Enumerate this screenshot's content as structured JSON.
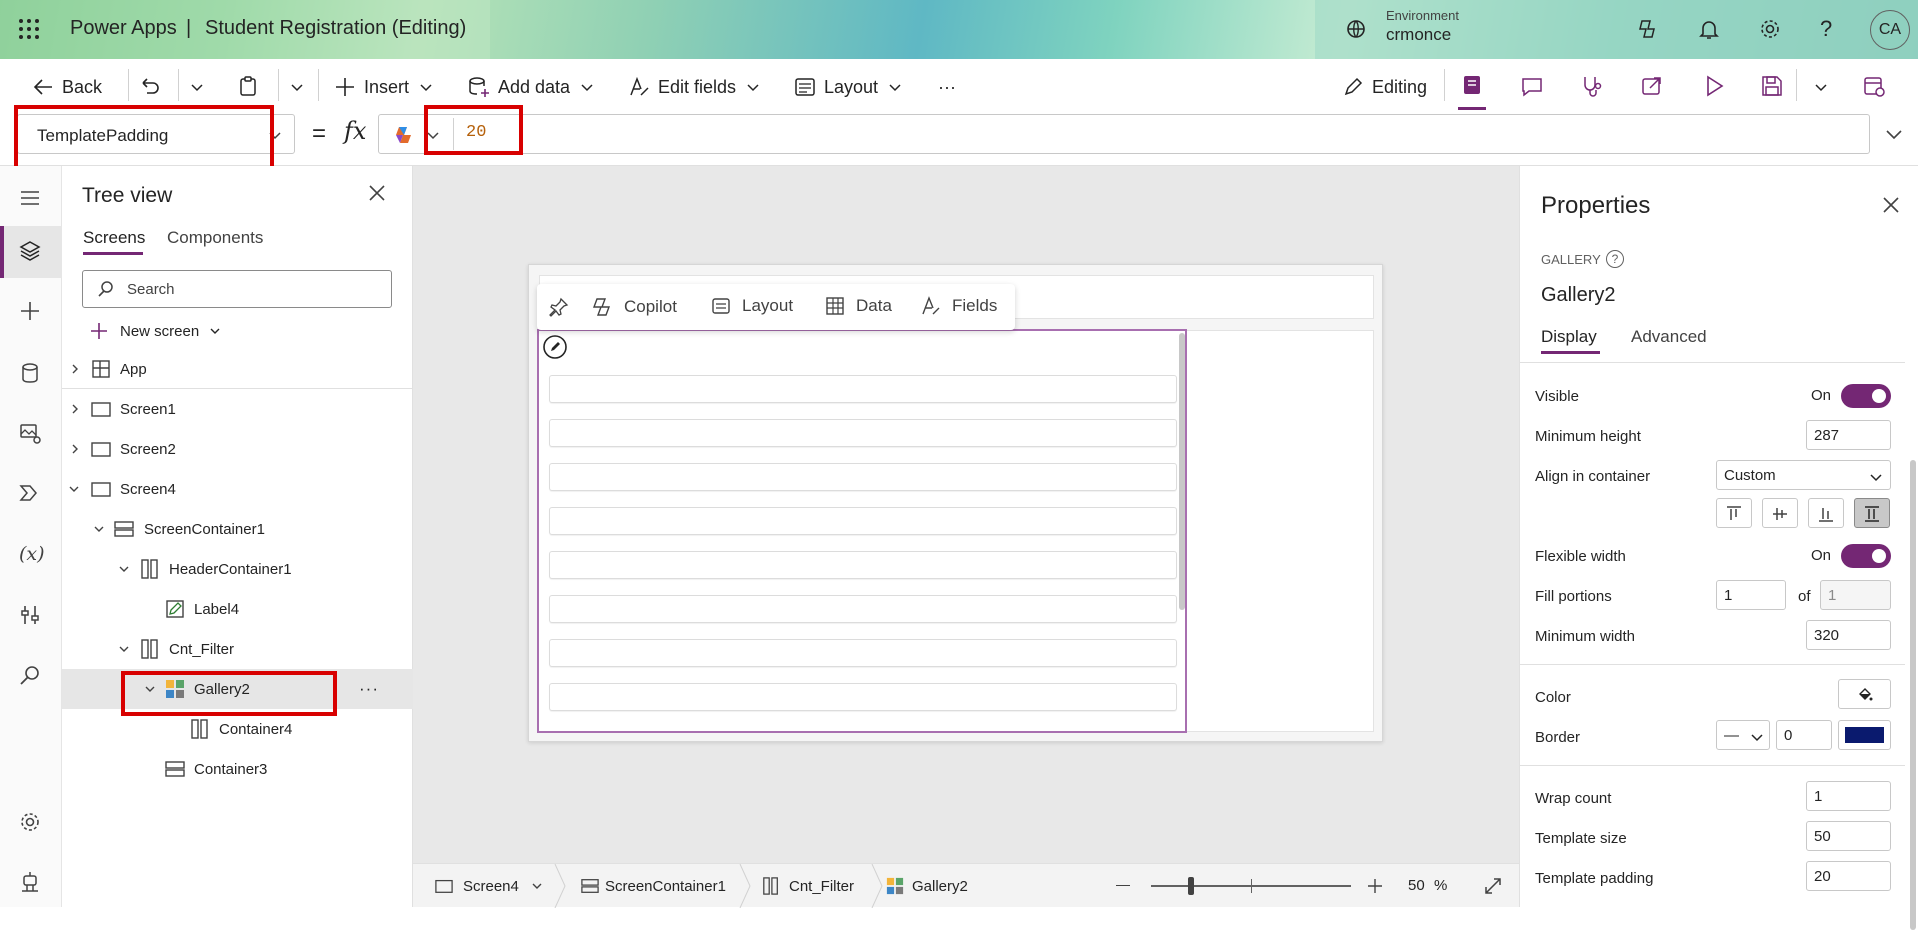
{
  "app": {
    "brand": "Power Apps",
    "separator": "|",
    "title": "Student Registration (Editing)"
  },
  "environment": {
    "label": "Environment",
    "name": "crmonce"
  },
  "user": {
    "initials": "CA"
  },
  "toolbar": {
    "back": "Back",
    "insert": "Insert",
    "add_data": "Add data",
    "edit_fields": "Edit fields",
    "layout": "Layout",
    "more": "···",
    "editing": "Editing"
  },
  "formula": {
    "property": "TemplatePadding",
    "equals": "=",
    "fx": "fx",
    "value": "20"
  },
  "tree": {
    "title": "Tree view",
    "tabs": [
      "Screens",
      "Components"
    ],
    "search_placeholder": "Search",
    "new_screen": "New screen",
    "items": [
      {
        "label": "App"
      },
      {
        "label": "Screen1"
      },
      {
        "label": "Screen2"
      },
      {
        "label": "Screen4"
      },
      {
        "label": "ScreenContainer1"
      },
      {
        "label": "HeaderContainer1"
      },
      {
        "label": "Label4"
      },
      {
        "label": "Cnt_Filter"
      },
      {
        "label": "Gallery2"
      },
      {
        "label": "Container4"
      },
      {
        "label": "Container3"
      }
    ],
    "row_more": "···"
  },
  "canvas": {
    "gallery_toolbar": [
      "Copilot",
      "Layout",
      "Data",
      "Fields"
    ]
  },
  "statusbar": {
    "breadcrumbs": [
      "Screen4",
      "ScreenContainer1",
      "Cnt_Filter",
      "Gallery2"
    ],
    "zoom_value": "50",
    "zoom_unit": "%",
    "zoom_level": 0.5
  },
  "properties": {
    "title": "Properties",
    "control_type": "GALLERY",
    "control_name": "Gallery2",
    "tabs": [
      "Display",
      "Advanced"
    ],
    "visible_label": "Visible",
    "visible_state": "On",
    "min_height_label": "Minimum height",
    "min_height_value": "287",
    "align_label": "Align in container",
    "align_value": "Custom",
    "flex_width_label": "Flexible width",
    "flex_width_state": "On",
    "fill_label": "Fill portions",
    "fill_value": "1",
    "fill_of": "of",
    "fill_total": "1",
    "min_width_label": "Minimum width",
    "min_width_value": "320",
    "color_label": "Color",
    "border_label": "Border",
    "border_style": "—",
    "border_width": "0",
    "border_color": "#0a1a6e",
    "wrap_label": "Wrap count",
    "wrap_value": "1",
    "template_size_label": "Template size",
    "template_size_value": "50",
    "template_padding_label": "Template padding",
    "template_padding_value": "20"
  },
  "colors": {
    "accent": "#742774",
    "highlight": "#d80000"
  }
}
